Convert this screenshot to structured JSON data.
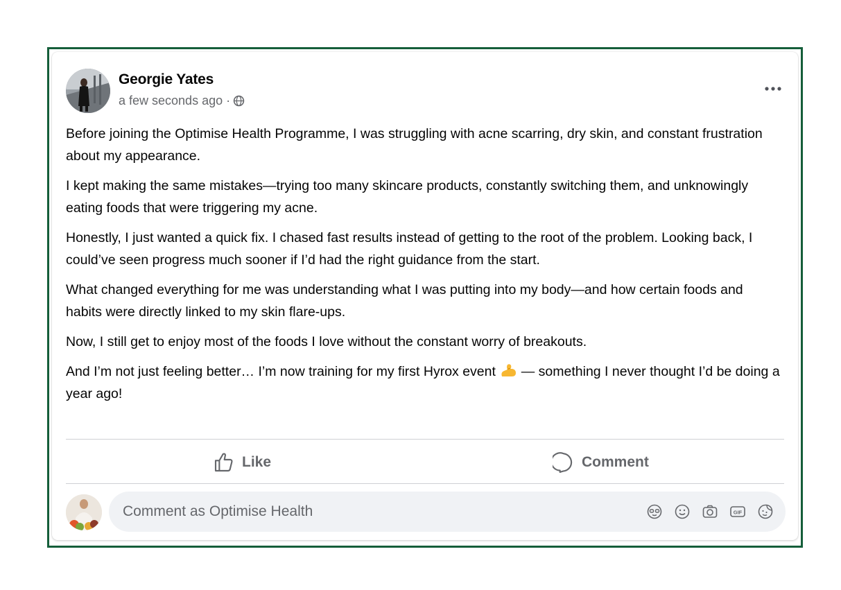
{
  "post": {
    "author": "Georgie Yates",
    "timestamp": "a few seconds ago ·",
    "privacy_icon": "globe-icon",
    "paragraphs": [
      "Before joining the Optimise Health Programme, I was struggling with acne scarring, dry skin, and constant frustration about my appearance.",
      "I kept making the same mistakes—trying too many skincare products, constantly switching them, and unknowingly eating foods that were triggering my acne.",
      "Honestly, I just wanted a quick fix. I chased fast results instead of getting to the root of the problem. Looking back, I could’ve seen progress much sooner if I’d had the right guidance from the start.",
      "What changed everything for me was understanding what I was putting into my body—and how certain foods and habits were directly linked to my skin flare-ups.",
      "Now, I still get to enjoy most of the foods I love without the constant worry of breakouts."
    ],
    "last_paragraph_before": "And I’m not just feeling better… I’m now training for my first Hyrox event",
    "last_paragraph_after": "— something I never thought I’d be doing a year ago!"
  },
  "actions": {
    "like_label": "Like",
    "comment_label": "Comment"
  },
  "composer": {
    "placeholder": "Comment as Optimise Health",
    "tools": [
      "avatar-sticker-icon",
      "emoji-icon",
      "camera-icon",
      "gif-icon",
      "sticker-icon"
    ]
  },
  "colors": {
    "frame_border": "#155e3a",
    "secondary_text": "#65676b",
    "composer_bg": "#f0f2f5"
  }
}
